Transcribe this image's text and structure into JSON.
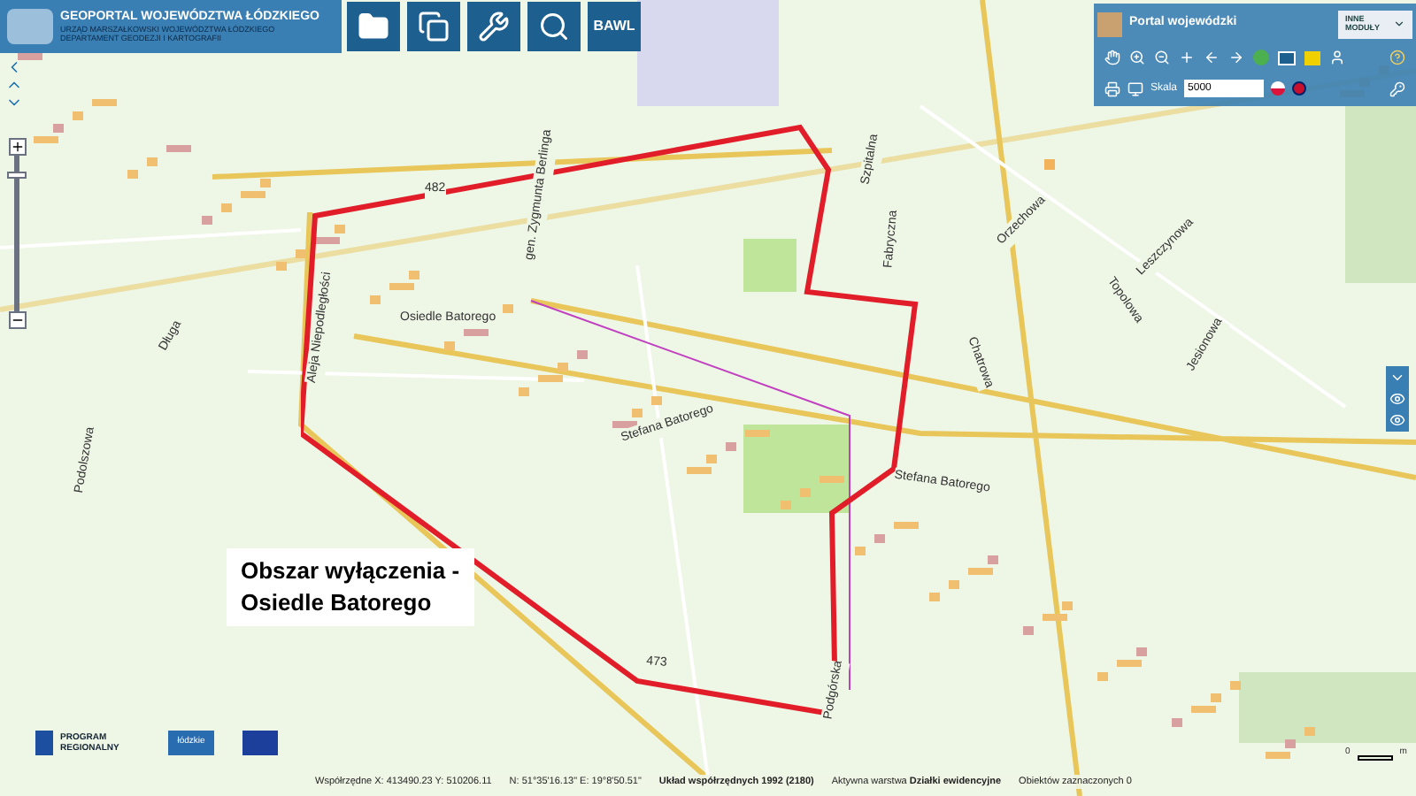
{
  "header": {
    "title": "GEOPORTAL WOJEWÓDZTWA ŁÓDZKIEGO",
    "subtitle": "URZĄD MARSZAŁKOWSKI WOJEWÓDZTWA ŁÓDZKIEGO",
    "department": "DEPARTAMENT GEODEZJI I KARTOGRAFII",
    "tools": [
      {
        "kind": "folder"
      },
      {
        "kind": "windows"
      },
      {
        "kind": "tools"
      },
      {
        "kind": "search"
      },
      {
        "kind": "text",
        "label": "BAWL"
      }
    ]
  },
  "portal": {
    "title": "Portal wojewódzki",
    "modules": "INNE MODUŁY",
    "scale_label": "Skala",
    "scale_value": "5000"
  },
  "map_labels": [
    {
      "text": "Stefana Batorego"
    },
    {
      "text": "Stefana Batorego"
    },
    {
      "text": "Szpitalna"
    },
    {
      "text": "Fabryczna"
    },
    {
      "text": "Chatrowa"
    },
    {
      "text": "Orzechowa"
    },
    {
      "text": "Topolowa"
    },
    {
      "text": "Leszczynowa"
    },
    {
      "text": "Jesionowa"
    },
    {
      "text": "Osiedle Batorego"
    },
    {
      "text": "Aleja Niepodległości"
    },
    {
      "text": "gen. Zygmunta Berlinga"
    },
    {
      "text": "482"
    },
    {
      "text": "473"
    },
    {
      "text": "Podolszowa"
    },
    {
      "text": "Długa"
    },
    {
      "text": "Podgórska"
    }
  ],
  "zoom": {
    "level": 0.9
  },
  "callout": {
    "lines": [
      "Obszar wyłączenia -",
      "Osiedle Batorego"
    ]
  },
  "logos": {
    "program": "PROGRAM REGIONALNY",
    "region": "łódzkie"
  },
  "scale_bar": {
    "zero": "0",
    "unit": "m"
  },
  "status_bar": {
    "coords": "Współrzędne X: 413490.23 Y: 510206.11",
    "geo": "N: 51°35'16.13\" E: 19°8'50.51\"",
    "crs": "**Układ współrzędnych 1992 (2180)**",
    "layer": "Aktywna warstwa **Działki ewidencyjne**",
    "selected": "Obiektów zaznaczonych 0"
  }
}
